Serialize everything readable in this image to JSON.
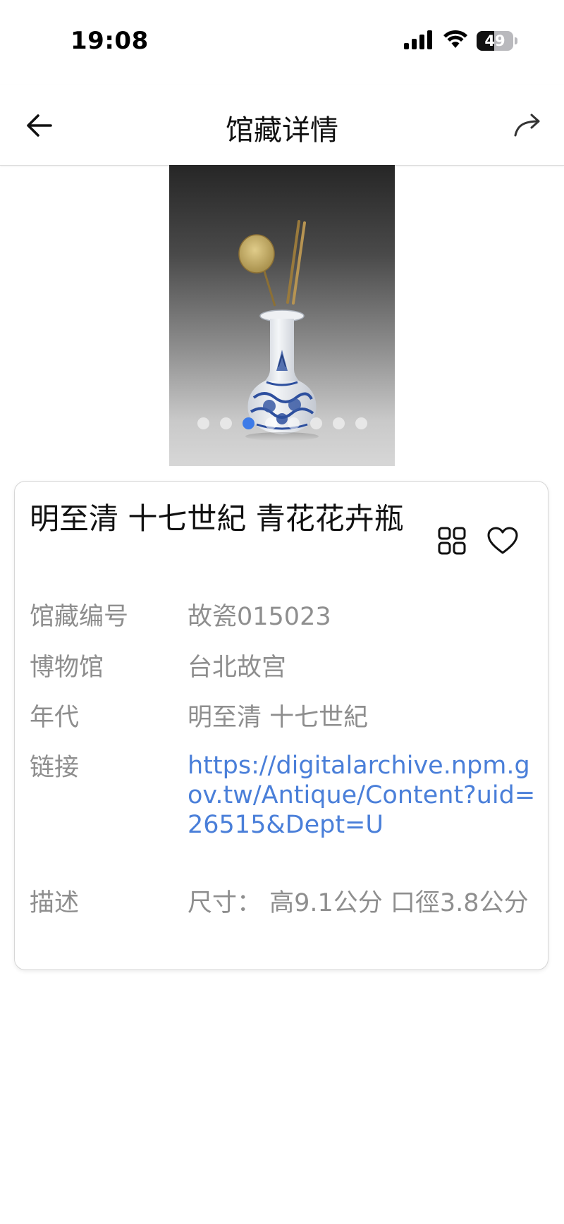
{
  "status_bar": {
    "time": "19:08",
    "battery_level": 49,
    "battery_text": "49",
    "icons": [
      "signal-icon",
      "wifi-icon",
      "battery-icon"
    ]
  },
  "nav": {
    "title": "馆藏详情",
    "back_icon": "arrow-left-icon",
    "share_icon": "share-arrow-icon"
  },
  "carousel": {
    "image_subject": "vase-photo",
    "dot_count": 8,
    "active_index": 2,
    "active_color": "#3d7be8"
  },
  "item": {
    "title": "明至清 十七世紀 青花花卉瓶",
    "grid_icon": "grid-icon",
    "favorite_icon": "heart-icon",
    "fields": {
      "collection_no": {
        "label": "馆藏编号",
        "value": "故瓷015023"
      },
      "museum": {
        "label": "博物馆",
        "value": "台北故宫"
      },
      "era": {
        "label": "年代",
        "value": "明至清 十七世紀"
      },
      "link": {
        "label": "链接",
        "value": "https://digitalarchive.npm.gov.tw/Antique/Content?uid=26515&Dept=U"
      },
      "description": {
        "label": "描述",
        "value": "尺寸： 高9.1公分 口徑3.8公分"
      }
    }
  },
  "colors": {
    "link": "#4a7fd9",
    "label_gray": "#8e8e8e",
    "title_text": "#111111"
  }
}
